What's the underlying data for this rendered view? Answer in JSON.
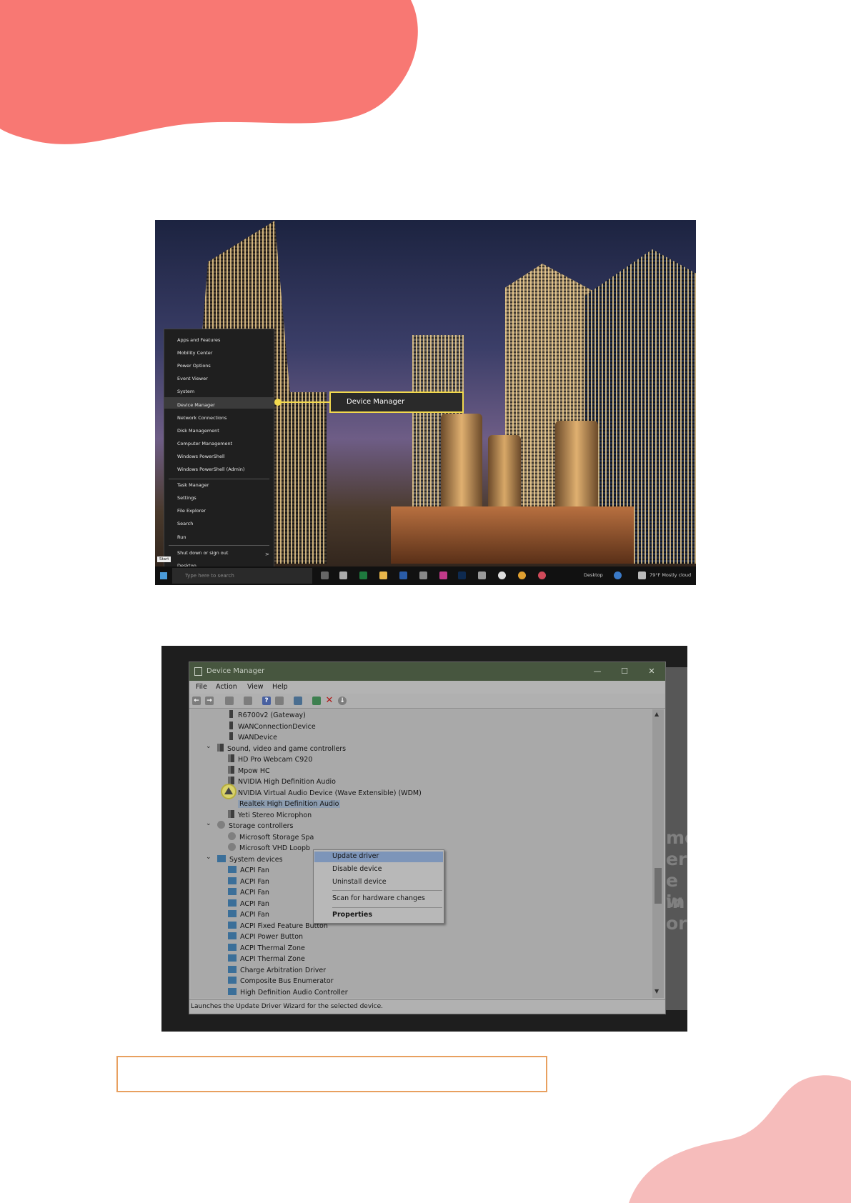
{
  "colors": {
    "blob_top": "#f87873",
    "blob_bottom": "#f6bcbb",
    "callout": "#f2d94e",
    "box_border": "#e8a060"
  },
  "shot1": {
    "winx_menu": {
      "group1": [
        "Apps and Features",
        "Mobility Center",
        "Power Options",
        "Event Viewer",
        "System",
        "Device Manager",
        "Network Connections",
        "Disk Management",
        "Computer Management",
        "Windows PowerShell",
        "Windows PowerShell (Admin)"
      ],
      "group2": [
        "Task Manager",
        "Settings",
        "File Explorer",
        "Search",
        "Run"
      ],
      "group3": [
        "Shut down or sign out",
        "Desktop"
      ],
      "selected": "Device Manager",
      "submenu_arrow": ">"
    },
    "callout_label": "Device Manager",
    "taskbar": {
      "start_tooltip": "Start",
      "search_placeholder": "Type here to search",
      "desktop_label": "Desktop",
      "weather": "79°F  Mostly cloud"
    }
  },
  "shot2": {
    "title": "Device Manager",
    "window_controls": [
      "—",
      "☐",
      "✕"
    ],
    "menu": [
      "File",
      "Action",
      "View",
      "Help"
    ],
    "tree": [
      {
        "label": "R6700v2 (Gateway)",
        "level": 2,
        "icon": "net"
      },
      {
        "label": "WANConnectionDevice",
        "level": 2,
        "icon": "net"
      },
      {
        "label": "WANDevice",
        "level": 2,
        "icon": "net"
      },
      {
        "label": "Sound, video and game controllers",
        "level": 1,
        "icon": "snd",
        "expanded": true
      },
      {
        "label": "HD Pro Webcam C920",
        "level": 2,
        "icon": "snd"
      },
      {
        "label": "Mpow HC",
        "level": 2,
        "icon": "snd"
      },
      {
        "label": "NVIDIA High Definition Audio",
        "level": 2,
        "icon": "snd"
      },
      {
        "label": "NVIDIA Virtual Audio Device (Wave Extensible) (WDM)",
        "level": 2,
        "icon": "snd"
      },
      {
        "label": "Realtek High Definition Audio",
        "level": 2,
        "icon": "warn",
        "selected": true
      },
      {
        "label": "Yeti Stereo Microphon",
        "level": 2,
        "icon": "snd"
      },
      {
        "label": "Storage controllers",
        "level": 1,
        "icon": "sto",
        "expanded": true
      },
      {
        "label": "Microsoft Storage Spa",
        "level": 2,
        "icon": "sto"
      },
      {
        "label": "Microsoft VHD Loopb",
        "level": 2,
        "icon": "sto"
      },
      {
        "label": "System devices",
        "level": 1,
        "icon": "sys",
        "expanded": true
      },
      {
        "label": "ACPI Fan",
        "level": 2,
        "icon": "sys"
      },
      {
        "label": "ACPI Fan",
        "level": 2,
        "icon": "sys"
      },
      {
        "label": "ACPI Fan",
        "level": 2,
        "icon": "sys"
      },
      {
        "label": "ACPI Fan",
        "level": 2,
        "icon": "sys"
      },
      {
        "label": "ACPI Fan",
        "level": 2,
        "icon": "sys"
      },
      {
        "label": "ACPI Fixed Feature Button",
        "level": 2,
        "icon": "sys"
      },
      {
        "label": "ACPI Power Button",
        "level": 2,
        "icon": "sys"
      },
      {
        "label": "ACPI Thermal Zone",
        "level": 2,
        "icon": "sys"
      },
      {
        "label": "ACPI Thermal Zone",
        "level": 2,
        "icon": "sys"
      },
      {
        "label": "Charge Arbitration Driver",
        "level": 2,
        "icon": "sys"
      },
      {
        "label": "Composite Bus Enumerator",
        "level": 2,
        "icon": "sys"
      },
      {
        "label": "High Definition Audio Controller",
        "level": 2,
        "icon": "sys"
      }
    ],
    "context_menu": {
      "update": "Update driver",
      "disable": "Disable device",
      "uninstall": "Uninstall device",
      "scan": "Scan for hardware changes",
      "properties": "Properties"
    },
    "status": "Launches the Update Driver Wizard for the selected device.",
    "background_text": [
      "mo",
      "er",
      "e w",
      "in",
      "or"
    ]
  }
}
